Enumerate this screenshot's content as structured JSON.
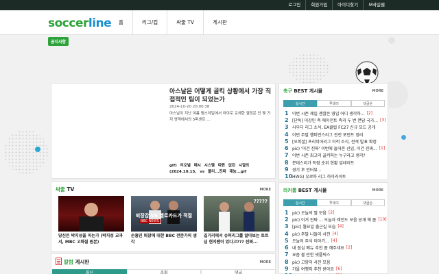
{
  "topbar": {
    "links": [
      "로그인",
      "회원가입",
      "아이디찾기",
      "모바일웹"
    ]
  },
  "logo": {
    "part1": "soccer",
    "part2": "line"
  },
  "nav": {
    "items": [
      "홈",
      "리그/컵",
      "싸줄 TV",
      "게시판"
    ]
  },
  "notice": {
    "label": "공지사항"
  },
  "headline": {
    "title": "아스날은 어떻게 골킥 상황에서 가장 직접적인 팀이 되었는가",
    "time": "2024-10-20 20:00:38",
    "summary": "아스날이 지난 여름 램스데일에서 라야로 교체한 결정은 단 몇 가지 영역에서의 5퍼센트 ...",
    "gif_line1": "gif) 리오넬 메시 시스템 따윈 없던 시절의",
    "gif_line2": "(2024.10.15, vs 볼리...진짜 재능...gif"
  },
  "tv": {
    "title_colored": "싸줄",
    "title_rest": "TV",
    "more": "MORE",
    "items": [
      {
        "caption": "당신은 박지성을 아는가 (박지성 교과서, MBC 고화질 원본)",
        "overlay": ""
      },
      {
        "caption": "손흥민 퇴장에 대한 BBC 전문가의 생각",
        "overlay": "퇴장감 VS 옐로카드가 적절",
        "badge": "BBC NEWS"
      },
      {
        "caption": "길거리에서 슈퍼리그를 알아보는 토트넘 현지팬이 있다고??? 진짜...",
        "overlay": "?????"
      }
    ]
  },
  "column": {
    "title_colored": "칼럼",
    "title_rest": "게시판",
    "more": "MORE",
    "tabs": [
      "최신",
      "조회",
      "댓글"
    ]
  },
  "best1": {
    "title_colored": "축구",
    "title_rest": "BEST 게시물",
    "more": "MORE",
    "tabs": [
      "실시간",
      "투데이",
      "댓글순"
    ],
    "items": [
      {
        "num": "1",
        "text": "이번 시즌 제일 괜찮은 영입 어디 생각하...",
        "count": "[2]"
      },
      {
        "num": "2",
        "text": "[단독] 이강인 측 에이전트 측과 두 번 면담 국가...",
        "count": "[3]"
      },
      {
        "num": "3",
        "text": "사우디 리그 소식, EA클럽 FC27 신규 모드 공개",
        "count": ""
      },
      {
        "num": "4",
        "text": "이번 주말 챔피언스리그 관전 포인트 정리",
        "count": ""
      },
      {
        "num": "5",
        "text": "[오피셜] 프리미어리그 이적 소식, 전격 발표 확정",
        "count": ""
      },
      {
        "num": "6",
        "text": "pic) '이건 진짜' 이번에 들어온 신입, 이건 진짜...",
        "count": "[1]"
      },
      {
        "num": "7",
        "text": "이번 시즌 최고의 골키퍼는 누구라고 생각?",
        "count": ""
      },
      {
        "num": "8",
        "text": "분데스리가 득점 순위 현황 업데이트",
        "count": ""
      },
      {
        "num": "9",
        "text": "경기 후 인터뷰...",
        "count": ""
      },
      {
        "num": "10",
        "text": "HWG) 유로파 리그 하이라이트",
        "count": ""
      }
    ]
  },
  "best2": {
    "title_colored": "라커룸",
    "title_rest": "BEST 게시물",
    "more": "MORE",
    "tabs": [
      "실시간",
      "투데이",
      "댓글순"
    ],
    "items": [
      {
        "num": "1",
        "text": "pic) 오늘의 짤 모음",
        "count": "[2]"
      },
      {
        "num": "2",
        "text": "pic) 이거 진짜 ... 오늘자 레전드 모음 공개 해 봄",
        "count": "[10]"
      },
      {
        "num": "3",
        "text": "[pic] 월요일 출근길 모습",
        "count": "[4]"
      },
      {
        "num": "4",
        "text": "pic) 주말 나들이 사진",
        "count": "[4]"
      },
      {
        "num": "5",
        "text": "오늘의 주식 이야기...",
        "count": "[4]"
      },
      {
        "num": "6",
        "text": "내 점심 메뉴 추천 좀 해주세요",
        "count": "[2]"
      },
      {
        "num": "7",
        "text": "요즘 볼 만한 넷플릭스",
        "count": ""
      },
      {
        "num": "8",
        "text": "pic) 고양이 사진 모음",
        "count": ""
      },
      {
        "num": "9",
        "text": "가을 여행지 추천 받아요",
        "count": "[6]"
      },
      {
        "num": "10",
        "text": "[pic] 야구 vs 축구 직관",
        "count": "[3]"
      }
    ]
  }
}
